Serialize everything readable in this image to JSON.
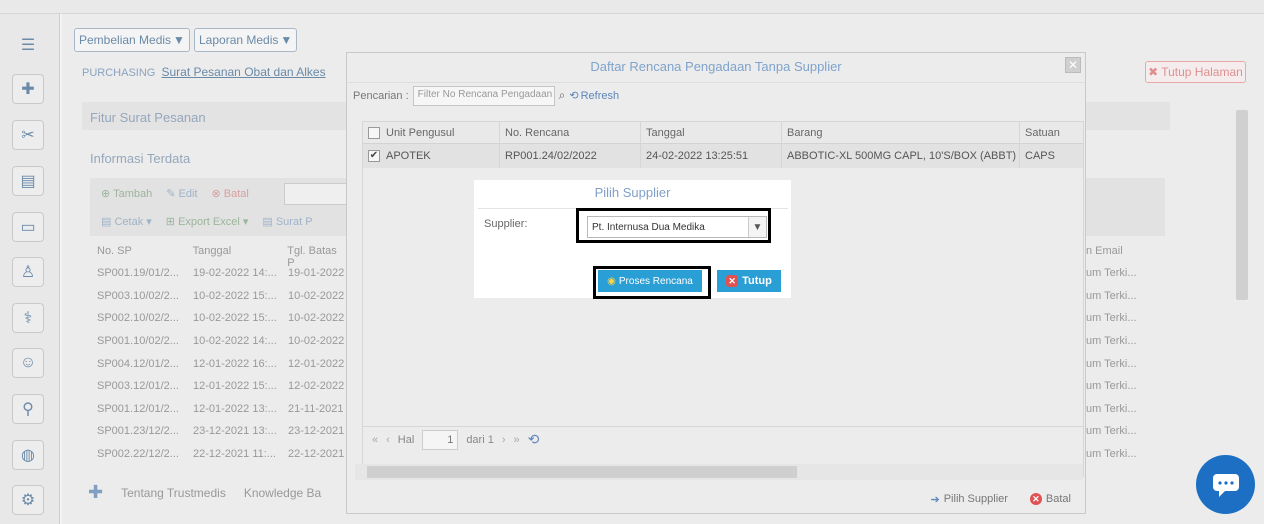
{
  "top_dropdowns": [
    "Pembelian Medis",
    "Laporan Medis"
  ],
  "breadcrumb": {
    "root": "PURCHASING",
    "current": "Surat Pesanan Obat dan Alkes"
  },
  "close_page_label": "Tutup Halaman",
  "sections": {
    "fitur": "Fitur Surat Pesanan",
    "info": "Informasi Terdata"
  },
  "toolbar": {
    "add": "Tambah",
    "edit": "Edit",
    "cancel": "Batal",
    "print": "Cetak",
    "export": "Export Excel",
    "letter": "Surat P"
  },
  "bg_table": {
    "headers": [
      "No. SP",
      "Tanggal",
      "Tgl. Batas P"
    ],
    "right_header": "n Email",
    "rows": [
      [
        "SP001.19/01/2...",
        "19-02-2022 14:...",
        "19-01-2022"
      ],
      [
        "SP003.10/02/2...",
        "10-02-2022 15:...",
        "10-02-2022"
      ],
      [
        "SP002.10/02/2...",
        "10-02-2022 15:...",
        "10-02-2022"
      ],
      [
        "SP001.10/02/2...",
        "10-02-2022 14:...",
        "10-02-2022"
      ],
      [
        "SP004.12/01/2...",
        "12-01-2022 16:...",
        "12-01-2022"
      ],
      [
        "SP003.12/01/2...",
        "12-01-2022 15:...",
        "12-02-2022"
      ],
      [
        "SP001.12/01/2...",
        "12-01-2022 13:...",
        "21-11-2021"
      ],
      [
        "SP001.23/12/2...",
        "23-12-2021 13:...",
        "23-12-2021"
      ],
      [
        "SP002.22/12/2...",
        "22-12-2021 11:...",
        "22-12-2021"
      ]
    ],
    "right_cell": "um Terki..."
  },
  "footer_links": [
    "Tentang Trustmedis",
    "Knowledge Ba"
  ],
  "dialog": {
    "title": "Daftar Rencana Pengadaan Tanpa Supplier",
    "search_label": "Pencarian :",
    "search_placeholder": "Filter No Rencana Pengadaan",
    "refresh": "Refresh",
    "columns": [
      "Unit Pengusul",
      "No. Rencana",
      "Tanggal",
      "Barang",
      "Satuan"
    ],
    "rows": [
      {
        "unit": "APOTEK",
        "no": "RP001.24/02/2022",
        "tanggal": "24-02-2022 13:25:51",
        "barang": "ABBOTIC-XL 500MG CAPL, 10'S/BOX (ABBT)",
        "satuan": "CAPS",
        "checked": true
      }
    ],
    "pager": {
      "hal": "Hal",
      "page": "1",
      "of": "dari 1"
    },
    "footer": {
      "choose": "Pilih Supplier",
      "cancel": "Batal"
    }
  },
  "popup": {
    "title": "Pilih Supplier",
    "supplier_label": "Supplier:",
    "supplier_value": "Pt. Internusa Dua  Medika",
    "process_button": "Proses Rencana",
    "close_button": "Tutup"
  }
}
